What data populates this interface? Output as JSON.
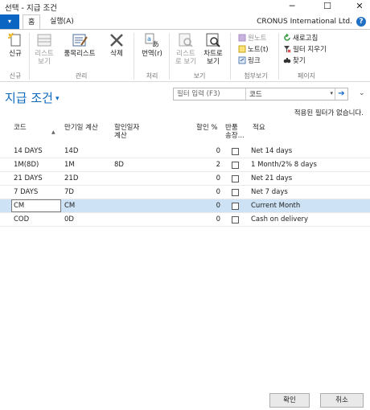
{
  "window": {
    "title": "선택 - 지급 조건",
    "minimize": "─",
    "maximize": "☐",
    "close": "✕"
  },
  "ribbon_tabs": {
    "file": "▾",
    "home": "홈",
    "actions": "실행(A)",
    "company": "CRONUS International Ltd.",
    "help": "?"
  },
  "ribbon": {
    "new_label": "신규",
    "group_new": "신규",
    "listview_label_1": "리스트",
    "listview_label_2": "보기",
    "editlist_label": "품목리스트",
    "delete_label": "삭제",
    "group_manage": "관리",
    "translate_label": "번역(r)",
    "group_process": "처리",
    "listreport_label_1": "리스트",
    "listreport_label_2": "로 보기",
    "chartview_label_1": "차트로",
    "chartview_label_2": "보기",
    "group_view": "보기",
    "onenote_label": "원노트",
    "notes_label": "노트(t)",
    "links_label": "링크",
    "group_attach": "첨부보기",
    "refresh_label": "새로고침",
    "clearfilter_label": "필터 지우기",
    "find_label": "찾기",
    "group_page": "페이지"
  },
  "page": {
    "title": "지급 조건",
    "title_caret": "▾",
    "filter_placeholder": "필터 입력 (F3)",
    "filter_field": "코드",
    "filter_dropdown": "▾",
    "filter_go": "➔",
    "collapse": "⌄",
    "no_filter_text": "적용된 필터가 없습니다."
  },
  "table": {
    "headers": {
      "code": "코드",
      "due_calc": "만기일 계산",
      "discount_calc_1": "할인일자",
      "discount_calc_2": "계산",
      "discount_pct": "할인 %",
      "credit_memo_1": "반품",
      "credit_memo_2": "송장...",
      "description": "적요",
      "sort_arrow": "▲"
    },
    "rows": [
      {
        "code": "14 DAYS",
        "due": "14D",
        "disc_date": "",
        "disc_pct": "0",
        "checked": false,
        "desc": "Net 14 days"
      },
      {
        "code": "1M(8D)",
        "due": "1M",
        "disc_date": "8D",
        "disc_pct": "2",
        "checked": false,
        "desc": "1 Month/2% 8 days"
      },
      {
        "code": "21 DAYS",
        "due": "21D",
        "disc_date": "",
        "disc_pct": "0",
        "checked": false,
        "desc": "Net 21 days"
      },
      {
        "code": "7 DAYS",
        "due": "7D",
        "disc_date": "",
        "disc_pct": "0",
        "checked": false,
        "desc": "Net 7 days"
      },
      {
        "code": "CM",
        "due": "CM",
        "disc_date": "",
        "disc_pct": "0",
        "checked": false,
        "desc": "Current Month"
      },
      {
        "code": "COD",
        "due": "0D",
        "disc_date": "",
        "disc_pct": "0",
        "checked": false,
        "desc": "Cash on delivery"
      }
    ],
    "selected_index": 4
  },
  "footer": {
    "ok": "확인",
    "cancel": "취소"
  },
  "colors": {
    "accent": "#0d6ac0",
    "file_tab": "#0a65c2",
    "selected_row": "#cde3f5"
  }
}
